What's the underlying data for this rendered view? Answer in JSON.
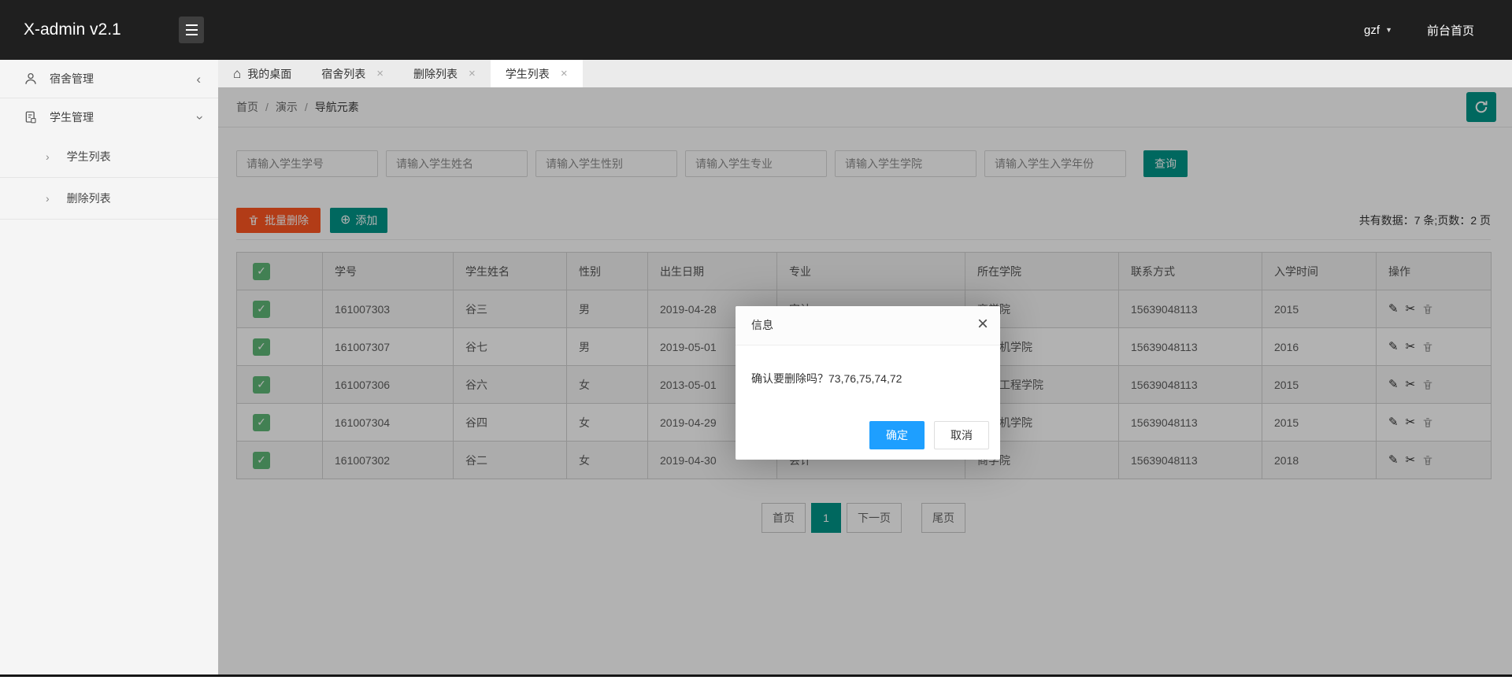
{
  "header": {
    "brand": "X-admin v2.1",
    "user": "gzf",
    "front_link": "前台首页"
  },
  "icons": {
    "home": "⌂",
    "close": "×",
    "caret_down": "▼",
    "chevron": "‹",
    "sub_arrow": "›",
    "edit": "✎",
    "cut": "✂",
    "plus": "⊕",
    "check": "✓",
    "slash": "/"
  },
  "sidebar": {
    "group1": "宿舍管理",
    "group2": "学生管理",
    "sub1": "学生列表",
    "sub2": "删除列表"
  },
  "tabs": {
    "t0": "我的桌面",
    "t1": "宿舍列表",
    "t2": "删除列表",
    "t3": "学生列表"
  },
  "breadcrumb": {
    "c0": "首页",
    "c1": "演示",
    "c2": "导航元素"
  },
  "search": {
    "placeholders": [
      "请输入学生学号",
      "请输入学生姓名",
      "请输入学生性别",
      "请输入学生专业",
      "请输入学生学院",
      "请输入学生入学年份"
    ],
    "submit": "查询"
  },
  "toolbar": {
    "batch_delete": "批量删除",
    "add": "添加",
    "summary": "共有数据：7 条;页数：2 页"
  },
  "table": {
    "headers": [
      "学号",
      "学生姓名",
      "性别",
      "出生日期",
      "专业",
      "所在学院",
      "联系方式",
      "入学时间",
      "操作"
    ],
    "rows": [
      {
        "id": "161007303",
        "name": "谷三",
        "gender": "男",
        "birthday": "2019-04-28",
        "major": "审计",
        "college": "商学院",
        "phone": "15639048113",
        "year": "2015"
      },
      {
        "id": "161007307",
        "name": "谷七",
        "gender": "男",
        "birthday": "2019-05-01",
        "major": "",
        "college": "计算机学院",
        "phone": "15639048113",
        "year": "2016"
      },
      {
        "id": "161007306",
        "name": "谷六",
        "gender": "女",
        "birthday": "2013-05-01",
        "major": "",
        "college": "智能工程学院",
        "phone": "15639048113",
        "year": "2015"
      },
      {
        "id": "161007304",
        "name": "谷四",
        "gender": "女",
        "birthday": "2019-04-29",
        "major": "",
        "college": "计算机学院",
        "phone": "15639048113",
        "year": "2015"
      },
      {
        "id": "161007302",
        "name": "谷二",
        "gender": "女",
        "birthday": "2019-04-30",
        "major": "会计",
        "college": "商学院",
        "phone": "15639048113",
        "year": "2018"
      }
    ]
  },
  "pagination": {
    "first": "首页",
    "page1": "1",
    "next": "下一页",
    "last": "尾页"
  },
  "modal": {
    "title": "信息",
    "message": "确认要删除吗？73,76,75,74,72",
    "confirm": "确定",
    "cancel": "取消"
  },
  "colors": {
    "accent_teal": "#009688",
    "danger_red": "#FF5722",
    "confirm_blue": "#1E9FFF",
    "checkbox_green": "#5FB878",
    "topbar_dark": "#1F1F1F"
  }
}
